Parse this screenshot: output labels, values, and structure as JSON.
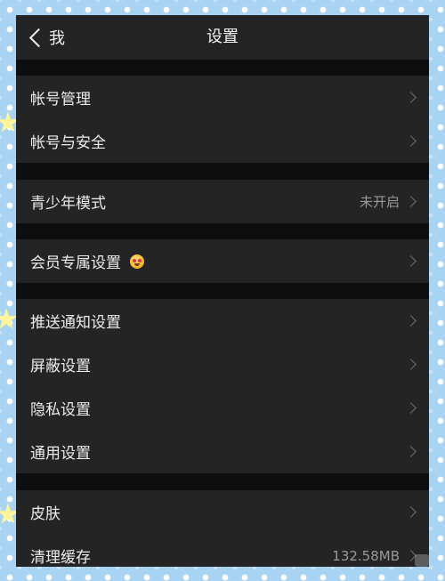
{
  "nav": {
    "back_label": "我",
    "title": "设置"
  },
  "groups": [
    {
      "items": [
        {
          "label": "帐号管理"
        },
        {
          "label": "帐号与安全"
        }
      ]
    },
    {
      "items": [
        {
          "label": "青少年模式",
          "value": "未开启"
        }
      ]
    },
    {
      "items": [
        {
          "label": "会员专属设置",
          "badge_icon": "crown-face-emoji"
        }
      ]
    },
    {
      "items": [
        {
          "label": "推送通知设置"
        },
        {
          "label": "屏蔽设置"
        },
        {
          "label": "隐私设置"
        },
        {
          "label": "通用设置"
        }
      ]
    },
    {
      "items": [
        {
          "label": "皮肤"
        },
        {
          "label": "清理缓存",
          "value": "132.58MB"
        }
      ]
    }
  ],
  "colors": {
    "frame_background": "#a9d3f3",
    "page_background": "#0e0e0e",
    "cell_background": "#242424",
    "primary_text": "#ececec",
    "secondary_text": "#9a9a9a"
  }
}
